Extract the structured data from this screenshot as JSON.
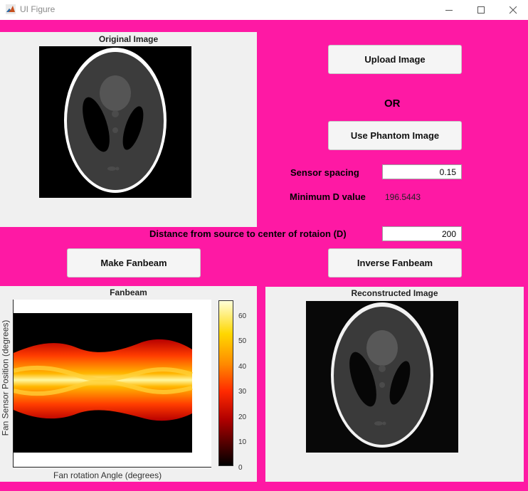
{
  "window": {
    "title": "UI Figure"
  },
  "panels": {
    "original": {
      "title": "Original Image"
    },
    "fanbeam": {
      "title": "Fanbeam",
      "xlabel": "Fan rotation Angle (degrees)",
      "ylabel": "Fan Sensor Position (degrees)",
      "colorbar_ticks": [
        "60",
        "50",
        "40",
        "30",
        "20",
        "10",
        "0"
      ]
    },
    "reconstructed": {
      "title": "Reconstructed Image"
    }
  },
  "controls": {
    "upload_label": "Upload Image",
    "or_label": "OR",
    "phantom_label": "Use Phantom Image",
    "sensor_spacing_label": "Sensor spacing",
    "sensor_spacing_value": "0.15",
    "min_d_label": "Minimum D value",
    "min_d_value": "196.5443",
    "distance_label": "Distance from source to center of rotaion (D)",
    "distance_value": "200",
    "make_fanbeam_label": "Make Fanbeam",
    "inverse_fanbeam_label": "Inverse Fanbeam"
  },
  "colors": {
    "figure_bg": "#fe19a4",
    "panel_bg": "#f0f0f0"
  }
}
